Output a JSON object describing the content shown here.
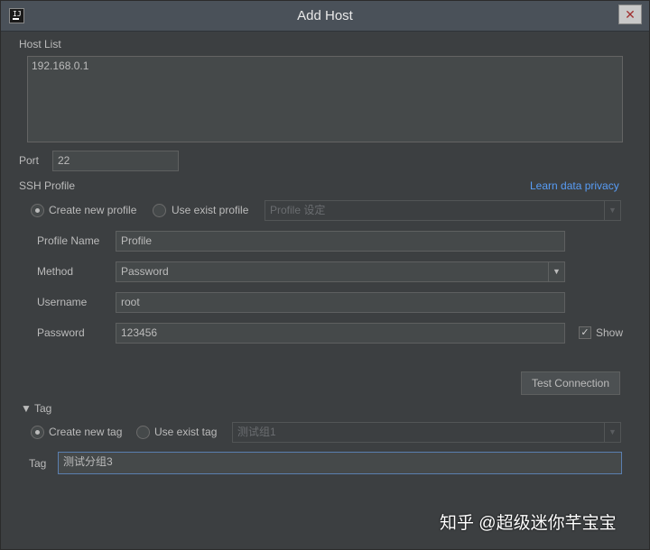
{
  "window": {
    "title": "Add Host",
    "close": "✕",
    "app_icon_letters": "IJ"
  },
  "host_list": {
    "label": "Host List",
    "value": "192.168.0.1"
  },
  "port": {
    "label": "Port",
    "value": "22"
  },
  "ssh_profile": {
    "label": "SSH Profile",
    "privacy_link": "Learn data privacy",
    "create_new_label": "Create new profile",
    "use_exist_label": "Use exist profile",
    "exist_profile_value": "Profile 设定",
    "selected_option": "Create new profile"
  },
  "profile": {
    "name_label": "Profile Name",
    "name_value": "Profile",
    "method_label": "Method",
    "method_value": "Password",
    "username_label": "Username",
    "username_value": "root",
    "password_label": "Password",
    "password_value": "123456",
    "show_label": "Show",
    "show_checked": true
  },
  "test_connection": {
    "label": "Test Connection"
  },
  "tag_section": {
    "toggle": "▼ Tag",
    "create_new_label": "Create new tag",
    "use_exist_label": "Use exist tag",
    "exist_tag_value": "测试组1",
    "selected_option": "Create new tag",
    "tag_label": "Tag",
    "tag_value": "测试分组3"
  },
  "icons": {
    "dropdown": "▼",
    "check": "✓"
  },
  "watermark": {
    "text": "知乎 @超级迷你芊宝宝"
  }
}
